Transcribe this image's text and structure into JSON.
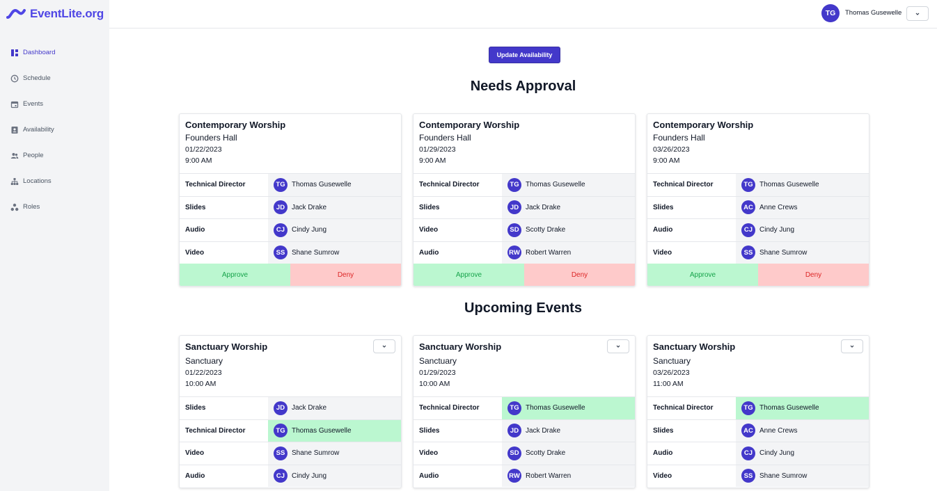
{
  "app": {
    "name": "EventLite.org"
  },
  "nav": [
    {
      "label": "Dashboard",
      "icon": "dashboard-icon",
      "active": true
    },
    {
      "label": "Schedule",
      "icon": "clock-icon"
    },
    {
      "label": "Events",
      "icon": "calendar-icon"
    },
    {
      "label": "Availability",
      "icon": "user-card-icon"
    },
    {
      "label": "People",
      "icon": "people-icon"
    },
    {
      "label": "Locations",
      "icon": "sitemap-icon"
    },
    {
      "label": "Roles",
      "icon": "roles-icon"
    }
  ],
  "header": {
    "user_initials": "TG",
    "user_name": "Thomas Gusewelle"
  },
  "main": {
    "update_label": "Update Availability",
    "needs_approval_title": "Needs Approval",
    "upcoming_title": "Upcoming Events",
    "approve_label": "Approve",
    "deny_label": "Deny"
  },
  "approval": [
    {
      "title": "Contemporary Worship",
      "location": "Founders Hall",
      "date": "01/22/2023",
      "time": "9:00 AM",
      "rows": [
        {
          "role": "Technical Director",
          "initials": "TG",
          "name": "Thomas Gusewelle"
        },
        {
          "role": "Slides",
          "initials": "JD",
          "name": "Jack Drake"
        },
        {
          "role": "Audio",
          "initials": "CJ",
          "name": "Cindy Jung"
        },
        {
          "role": "Video",
          "initials": "SS",
          "name": "Shane Sumrow"
        }
      ]
    },
    {
      "title": "Contemporary Worship",
      "location": "Founders Hall",
      "date": "01/29/2023",
      "time": "9:00 AM",
      "rows": [
        {
          "role": "Technical Director",
          "initials": "TG",
          "name": "Thomas Gusewelle"
        },
        {
          "role": "Slides",
          "initials": "JD",
          "name": "Jack Drake"
        },
        {
          "role": "Video",
          "initials": "SD",
          "name": "Scotty Drake"
        },
        {
          "role": "Audio",
          "initials": "RW",
          "name": "Robert Warren"
        }
      ]
    },
    {
      "title": "Contemporary Worship",
      "location": "Founders Hall",
      "date": "03/26/2023",
      "time": "9:00 AM",
      "rows": [
        {
          "role": "Technical Director",
          "initials": "TG",
          "name": "Thomas Gusewelle"
        },
        {
          "role": "Slides",
          "initials": "AC",
          "name": "Anne Crews"
        },
        {
          "role": "Audio",
          "initials": "CJ",
          "name": "Cindy Jung"
        },
        {
          "role": "Video",
          "initials": "SS",
          "name": "Shane Sumrow"
        }
      ]
    }
  ],
  "upcoming": [
    {
      "title": "Sanctuary Worship",
      "location": "Sanctuary",
      "date": "01/22/2023",
      "time": "10:00 AM",
      "rows": [
        {
          "role": "Slides",
          "initials": "JD",
          "name": "Jack Drake"
        },
        {
          "role": "Technical Director",
          "initials": "TG",
          "name": "Thomas Gusewelle",
          "highlight": true
        },
        {
          "role": "Video",
          "initials": "SS",
          "name": "Shane Sumrow"
        },
        {
          "role": "Audio",
          "initials": "CJ",
          "name": "Cindy Jung"
        }
      ]
    },
    {
      "title": "Sanctuary Worship",
      "location": "Sanctuary",
      "date": "01/29/2023",
      "time": "10:00 AM",
      "rows": [
        {
          "role": "Technical Director",
          "initials": "TG",
          "name": "Thomas Gusewelle",
          "highlight": true
        },
        {
          "role": "Slides",
          "initials": "JD",
          "name": "Jack Drake"
        },
        {
          "role": "Video",
          "initials": "SD",
          "name": "Scotty Drake"
        },
        {
          "role": "Audio",
          "initials": "RW",
          "name": "Robert Warren"
        }
      ]
    },
    {
      "title": "Sanctuary Worship",
      "location": "Sanctuary",
      "date": "03/26/2023",
      "time": "11:00 AM",
      "rows": [
        {
          "role": "Technical Director",
          "initials": "TG",
          "name": "Thomas Gusewelle",
          "highlight": true
        },
        {
          "role": "Slides",
          "initials": "AC",
          "name": "Anne Crews"
        },
        {
          "role": "Audio",
          "initials": "CJ",
          "name": "Cindy Jung"
        },
        {
          "role": "Video",
          "initials": "SS",
          "name": "Shane Sumrow"
        }
      ]
    }
  ]
}
